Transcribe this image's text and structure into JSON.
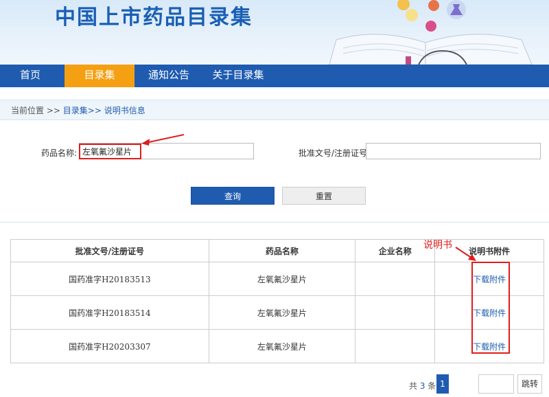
{
  "header": {
    "site_title": "中国上市药品目录集"
  },
  "nav": {
    "items": [
      "首页",
      "目录集",
      "通知公告",
      "关于目录集"
    ],
    "active": "目录集"
  },
  "breadcrumb": {
    "prefix": "当前位置 >> ",
    "level1": "目录集",
    "sep": ">> ",
    "level2": "说明书信息"
  },
  "search": {
    "drug_name_label": "药品名称:",
    "drug_name_value": "左氧氟沙星片",
    "approval_label": "批准文号/注册证号:",
    "approval_value": "",
    "query_button": "查询",
    "reset_button": "重置"
  },
  "table": {
    "columns": [
      "批准文号/注册证号",
      "药品名称",
      "企业名称",
      "说明书附件"
    ],
    "rows": [
      {
        "approval": "国药准字H20183513",
        "name": "左氧氟沙星片",
        "company": "",
        "attachment": "下载附件"
      },
      {
        "approval": "国药准字H20183514",
        "name": "左氧氟沙星片",
        "company": "",
        "attachment": "下载附件"
      },
      {
        "approval": "国药准字H20203307",
        "name": "左氧氟沙星片",
        "company": "",
        "attachment": "下载附件"
      }
    ]
  },
  "annotation": {
    "label": "说明书",
    "color": "#e01b1b"
  },
  "pager": {
    "total_prefix": "共 ",
    "total_count": "3",
    "total_suffix": " 条",
    "current_page": "1",
    "jump_label": "跳转"
  },
  "colors": {
    "primary": "#1f5cb0",
    "accent": "#f5a013",
    "annotation": "#e01b1b"
  }
}
